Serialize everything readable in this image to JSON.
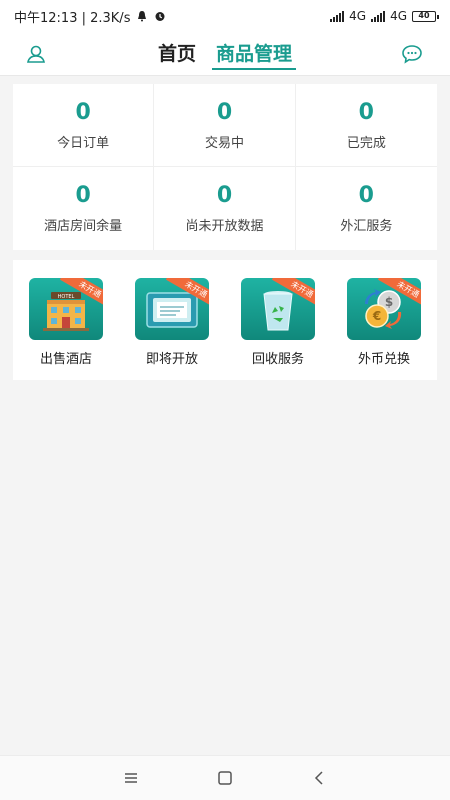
{
  "status_bar": {
    "time_speed": "中午12:13 | 2.3K/s",
    "network_1": "4G",
    "network_2": "4G",
    "battery": "40"
  },
  "header": {
    "tabs": [
      {
        "label": "首页",
        "active": false
      },
      {
        "label": "商品管理",
        "active": true
      }
    ],
    "accent_color": "#1a9c8f"
  },
  "stats": [
    {
      "value": "0",
      "label": "今日订单"
    },
    {
      "value": "0",
      "label": "交易中"
    },
    {
      "value": "0",
      "label": "已完成"
    },
    {
      "value": "0",
      "label": "酒店房间余量"
    },
    {
      "value": "0",
      "label": "尚未开放数据"
    },
    {
      "value": "0",
      "label": "外汇服务"
    }
  ],
  "services": [
    {
      "label": "出售酒店",
      "badge": "未开通",
      "icon": "hotel-icon"
    },
    {
      "label": "即将开放",
      "badge": "未开通",
      "icon": "ticket-icon"
    },
    {
      "label": "回收服务",
      "badge": "未开通",
      "icon": "recycle-bin-icon"
    },
    {
      "label": "外币兑换",
      "badge": "未开通",
      "icon": "currency-exchange-icon"
    }
  ],
  "colors": {
    "tile_gradient_top": "#1fb3a3",
    "tile_gradient_bottom": "#10887b",
    "badge": "#f06a3a"
  }
}
